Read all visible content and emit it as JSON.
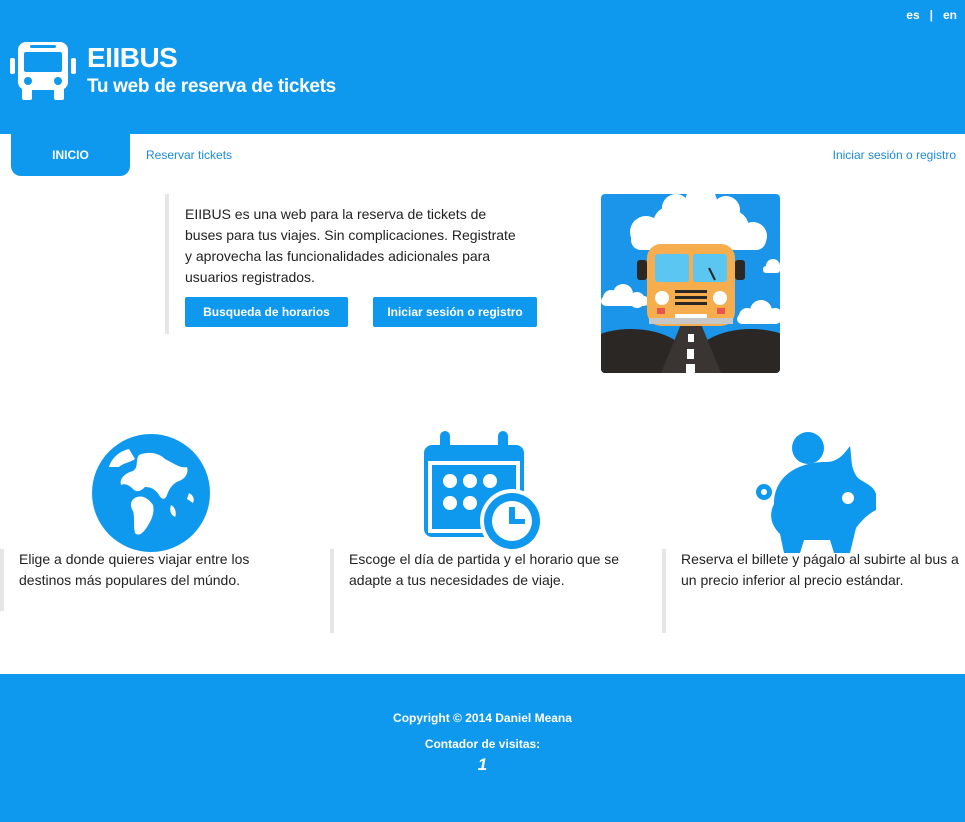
{
  "header": {
    "title": "EIIBUS",
    "subtitle": "Tu web de reserva de tickets",
    "languages": [
      "es",
      "|",
      "en"
    ],
    "logo_icon": "bus-icon"
  },
  "nav": {
    "home": "INICIO",
    "book": "Reservar tickets",
    "login": "Iniciar sesión o registro"
  },
  "intro": {
    "text": "EIIBUS es una web para la reserva de tickets de buses para tus viajes. Sin complicaciones. Registrate y aprovecha las funcionalidades adicionales para usuarios registrados.",
    "search_button": "Busqueda de horarios",
    "login_button": "Iniciar sesión o registro"
  },
  "features": [
    {
      "icon": "globe-icon",
      "text": "Elige a donde quieres viajar entre los destinos más populares del múndo."
    },
    {
      "icon": "calendar-clock-icon",
      "text": "Escoge el día de partida y el horario que se adapte a tus necesidades de viaje."
    },
    {
      "icon": "piggy-bank-icon",
      "text": "Reserva el billete y págalo al subirte al bus a un precio inferior al precio estándar."
    }
  ],
  "footer": {
    "copyright": "Copyright © 2014 Daniel Meana",
    "counter_label": "Contador de visitas:",
    "counter_value": "1"
  },
  "colors": {
    "brand": "#0f99ee",
    "link": "#1a8ad8",
    "bus": "#f6ad4e"
  }
}
